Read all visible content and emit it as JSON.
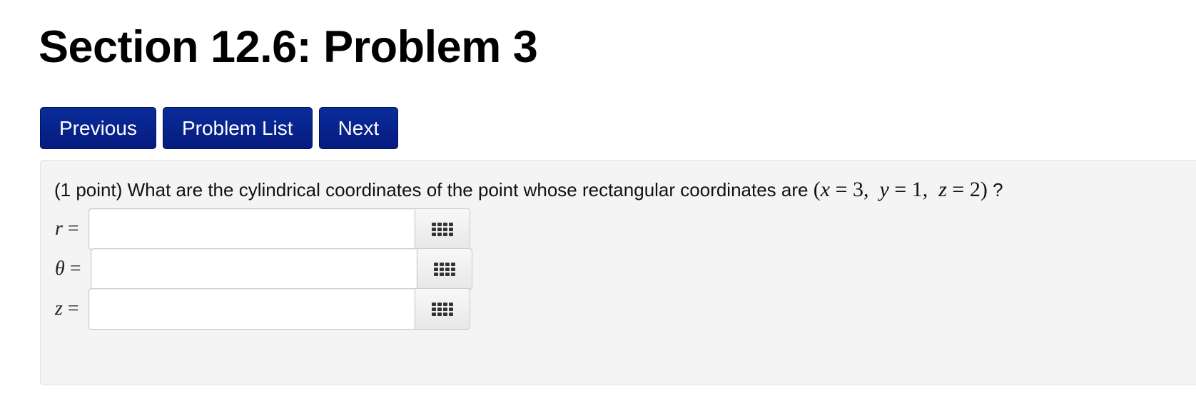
{
  "page": {
    "title": "Section 12.6: Problem 3"
  },
  "nav": {
    "previous_label": "Previous",
    "problem_list_label": "Problem List",
    "next_label": "Next"
  },
  "problem": {
    "points": "(1 point)",
    "question": "What are the cylindrical coordinates of the point whose rectangular coordinates are",
    "coords": {
      "open": "(",
      "x_var": "x",
      "x_val": "= 3,",
      "y_var": "y",
      "y_val": "= 1,",
      "z_var": "z",
      "z_val": "= 2)"
    },
    "question_end": "?"
  },
  "answers": [
    {
      "var": "r",
      "eq": "=",
      "value": ""
    },
    {
      "var": "θ",
      "eq": "=",
      "value": ""
    },
    {
      "var": "z",
      "eq": "=",
      "value": ""
    }
  ],
  "icons": {
    "palette": "equation-palette-icon"
  },
  "colors": {
    "nav_button": "#061a80",
    "panel_bg": "#f4f4f4"
  }
}
